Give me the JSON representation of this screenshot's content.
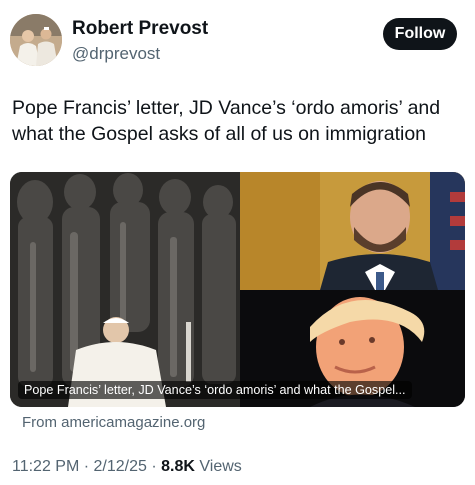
{
  "author": {
    "name": "Robert Prevost",
    "handle": "@drprevost"
  },
  "follow_label": "Follow",
  "tweet_text": "Pope Francis’ letter, JD Vance’s ‘ordo amoris’ and what the Gospel asks of all of us on immigration",
  "link_card": {
    "caption": "Pope Francis’ letter, JD Vance’s ‘ordo amoris’ and what the Gospel...",
    "source": "From americamagazine.org"
  },
  "meta": {
    "time": "11:22 PM",
    "separator": "·",
    "date": "2/12/25",
    "views_count": "8.8K",
    "views_label": "Views"
  },
  "colors": {
    "follow_bg": "#0f1419",
    "muted_text": "#536471"
  }
}
